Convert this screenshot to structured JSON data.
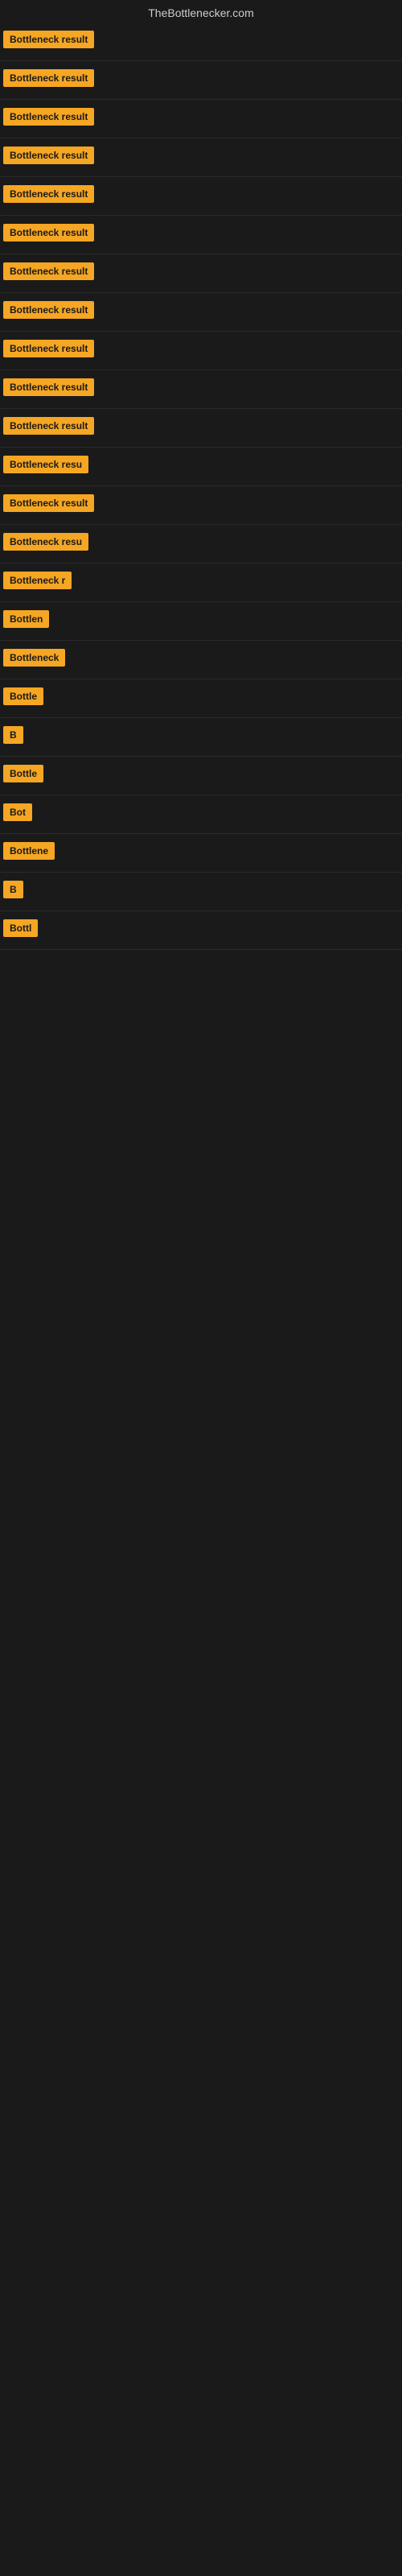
{
  "site": {
    "title": "TheBottlenecker.com"
  },
  "results": [
    {
      "id": 1,
      "label": "Bottleneck result",
      "width": 85
    },
    {
      "id": 2,
      "label": "Bottleneck result",
      "width": 85
    },
    {
      "id": 3,
      "label": "Bottleneck result",
      "width": 85
    },
    {
      "id": 4,
      "label": "Bottleneck result",
      "width": 85
    },
    {
      "id": 5,
      "label": "Bottleneck result",
      "width": 85
    },
    {
      "id": 6,
      "label": "Bottleneck result",
      "width": 85
    },
    {
      "id": 7,
      "label": "Bottleneck result",
      "width": 85
    },
    {
      "id": 8,
      "label": "Bottleneck result",
      "width": 85
    },
    {
      "id": 9,
      "label": "Bottleneck result",
      "width": 85
    },
    {
      "id": 10,
      "label": "Bottleneck result",
      "width": 85
    },
    {
      "id": 11,
      "label": "Bottleneck result",
      "width": 85
    },
    {
      "id": 12,
      "label": "Bottleneck resu",
      "width": 78
    },
    {
      "id": 13,
      "label": "Bottleneck result",
      "width": 85
    },
    {
      "id": 14,
      "label": "Bottleneck resu",
      "width": 78
    },
    {
      "id": 15,
      "label": "Bottleneck r",
      "width": 62
    },
    {
      "id": 16,
      "label": "Bottlen",
      "width": 48
    },
    {
      "id": 17,
      "label": "Bottleneck",
      "width": 58
    },
    {
      "id": 18,
      "label": "Bottle",
      "width": 42
    },
    {
      "id": 19,
      "label": "B",
      "width": 14
    },
    {
      "id": 20,
      "label": "Bottle",
      "width": 42
    },
    {
      "id": 21,
      "label": "Bot",
      "width": 26
    },
    {
      "id": 22,
      "label": "Bottlene",
      "width": 52
    },
    {
      "id": 23,
      "label": "B",
      "width": 14
    },
    {
      "id": 24,
      "label": "Bottl",
      "width": 36
    }
  ]
}
